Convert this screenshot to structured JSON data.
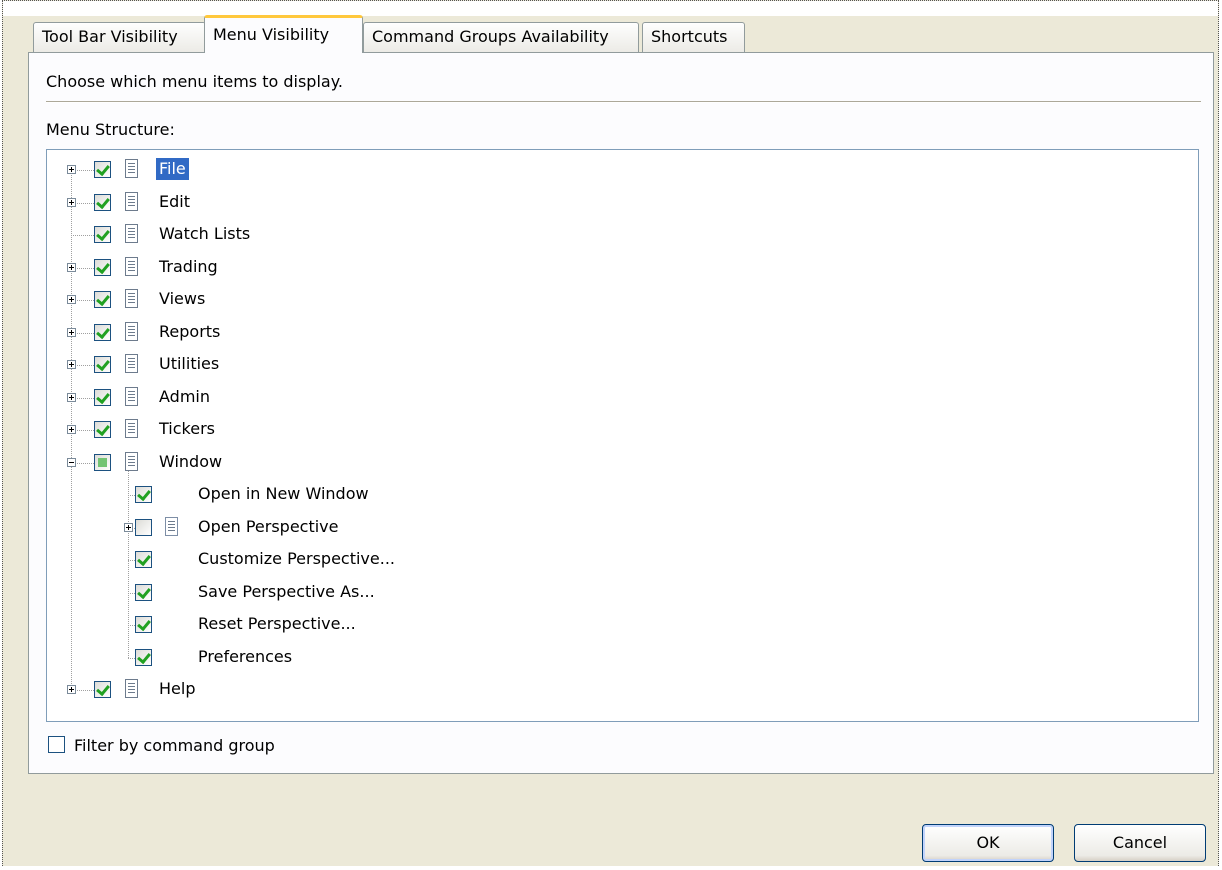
{
  "tabs": [
    {
      "label": "Tool Bar Visibility",
      "active": false
    },
    {
      "label": "Menu Visibility",
      "active": true
    },
    {
      "label": "Command Groups Availability",
      "active": false
    },
    {
      "label": "Shortcuts",
      "active": false
    }
  ],
  "panel": {
    "description": "Choose which menu items to display.",
    "tree_label": "Menu Structure:"
  },
  "tree": {
    "items": [
      {
        "label": "File",
        "checked": "checked",
        "expandable": true,
        "expanded": false,
        "selected": true
      },
      {
        "label": "Edit",
        "checked": "checked",
        "expandable": true,
        "expanded": false
      },
      {
        "label": "Watch Lists",
        "checked": "checked",
        "expandable": false
      },
      {
        "label": "Trading",
        "checked": "checked",
        "expandable": true,
        "expanded": false
      },
      {
        "label": "Views",
        "checked": "checked",
        "expandable": true,
        "expanded": false
      },
      {
        "label": "Reports",
        "checked": "checked",
        "expandable": true,
        "expanded": false
      },
      {
        "label": "Utilities",
        "checked": "checked",
        "expandable": true,
        "expanded": false
      },
      {
        "label": "Admin",
        "checked": "checked",
        "expandable": true,
        "expanded": false
      },
      {
        "label": "Tickers",
        "checked": "checked",
        "expandable": true,
        "expanded": false
      },
      {
        "label": "Window",
        "checked": "partial",
        "expandable": true,
        "expanded": true
      },
      {
        "label": "Help",
        "checked": "checked",
        "expandable": true,
        "expanded": false
      }
    ],
    "window_children": [
      {
        "label": "Open in New Window",
        "checked": "checked",
        "expandable": false
      },
      {
        "label": "Open Perspective",
        "checked": "unchecked",
        "expandable": true,
        "expanded": false
      },
      {
        "label": "Customize Perspective...",
        "checked": "checked",
        "expandable": false
      },
      {
        "label": "Save Perspective As...",
        "checked": "checked",
        "expandable": false
      },
      {
        "label": "Reset Perspective...",
        "checked": "checked",
        "expandable": false
      },
      {
        "label": "Preferences",
        "checked": "checked",
        "expandable": false
      }
    ]
  },
  "filter": {
    "label": "Filter by command group",
    "checked": false
  },
  "buttons": {
    "ok": "OK",
    "cancel": "Cancel"
  }
}
